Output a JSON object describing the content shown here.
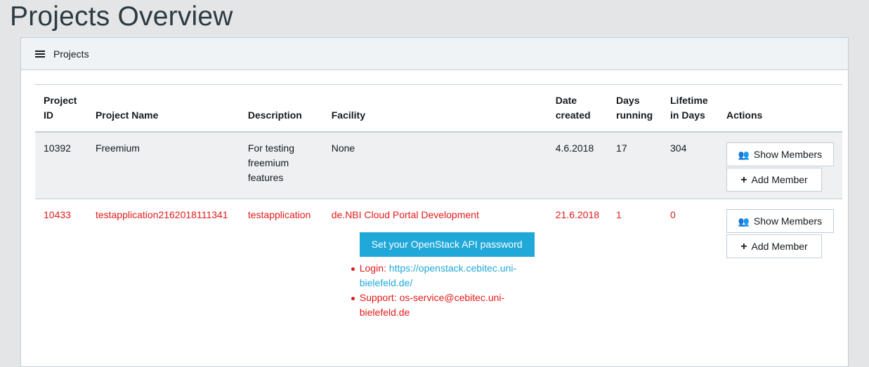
{
  "page": {
    "title": "Projects Overview"
  },
  "card": {
    "header": "Projects"
  },
  "table": {
    "headers": {
      "project_id": "Project ID",
      "project_name": "Project Name",
      "description": "Description",
      "facility": "Facility",
      "date_created": "Date created",
      "days_running": "Days running",
      "lifetime": "Lifetime in Days",
      "actions": "Actions"
    },
    "rows": [
      {
        "id": "10392",
        "name": "Freemium",
        "description": "For testing freemium features",
        "facility": "None",
        "date_created": "4.6.2018",
        "days_running": "17",
        "lifetime": "304",
        "show_members": "Show Members",
        "add_member": "Add Member"
      },
      {
        "id": "10433",
        "name": "testapplication2162018111341",
        "description": "testapplication",
        "facility": "de.NBI Cloud Portal Development",
        "date_created": "21.6.2018",
        "days_running": "1",
        "lifetime": "0",
        "show_members": "Show Members",
        "add_member": "Add Member",
        "api_button": "Set your OpenStack API password",
        "login_label": "Login: ",
        "login_url": "https://openstack.cebitec.uni-bielefeld.de/",
        "support_label": "Support: ",
        "support_email": "os-service@cebitec.uni-bielefeld.de"
      }
    ]
  },
  "colors": {
    "accent": "#20a8d8",
    "danger": "#e21b1b",
    "background": "#e4e5e6"
  },
  "icons": {
    "header": "list-icon",
    "show_members": "users-icon",
    "add_member": "plus-icon"
  }
}
